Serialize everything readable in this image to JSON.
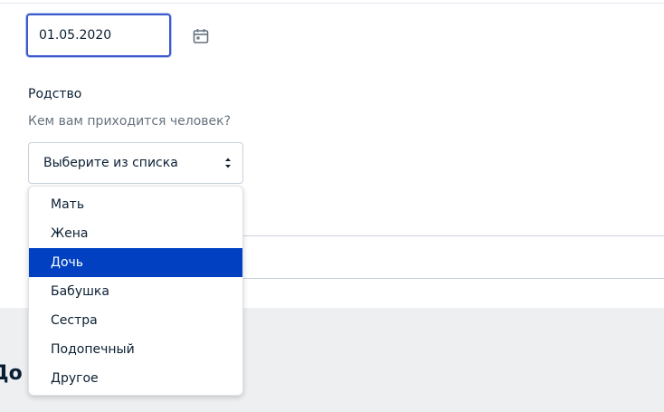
{
  "date_field": {
    "value": "01.05.2020"
  },
  "relation": {
    "label": "Родство",
    "hint": "Кем вам приходится человек?",
    "select_value": "Выберите из списка",
    "options": [
      {
        "label": "Мать"
      },
      {
        "label": "Жена"
      },
      {
        "label": "Дочь"
      },
      {
        "label": "Бабушка"
      },
      {
        "label": "Сестра"
      },
      {
        "label": "Подопечный"
      },
      {
        "label": "Другое"
      }
    ],
    "highlighted_option": "Дочь"
  },
  "section_heading": "До",
  "icons": {
    "calendar": "calendar-icon",
    "select_arrow": "chevron-updown-icon"
  },
  "colors": {
    "focus_border": "#3b5bcc",
    "highlight": "#0040c1",
    "text": "#0b1f33",
    "hint": "#66727f",
    "page_bg": "#eeeff1"
  }
}
